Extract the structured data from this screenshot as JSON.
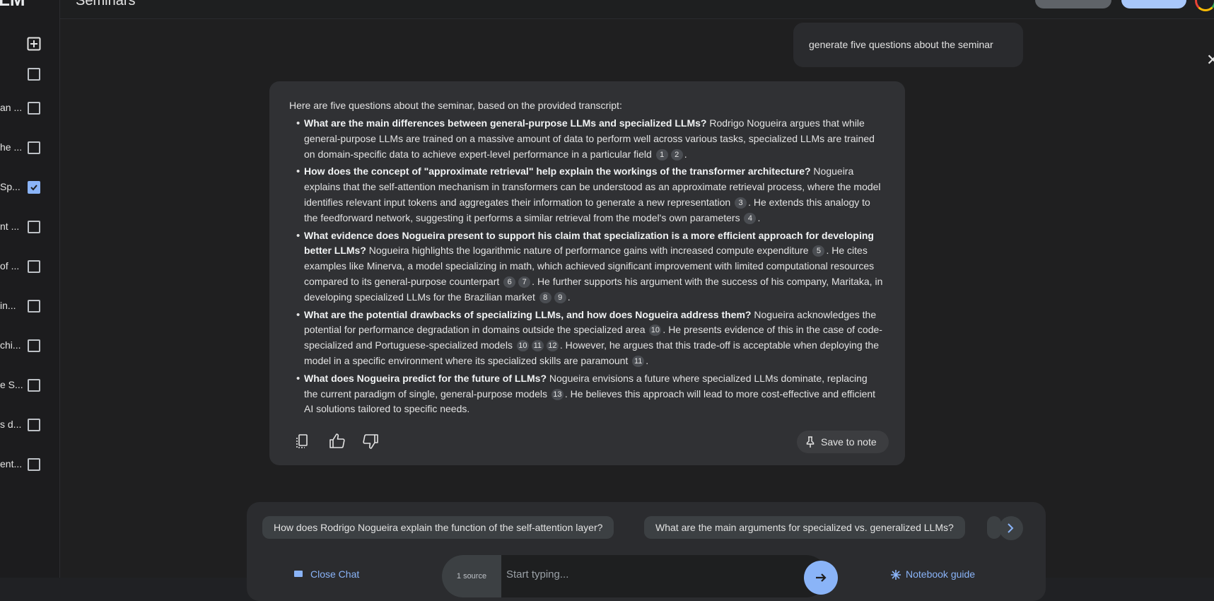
{
  "app": {
    "brand": "LM",
    "notebook_title": "Seminars"
  },
  "sidebar": {
    "sources": [
      {
        "label": "",
        "checked": false
      },
      {
        "label": "an ...",
        "checked": false
      },
      {
        "label": "he ...",
        "checked": false
      },
      {
        "label": "Sp...",
        "checked": true
      },
      {
        "label": "nt ...",
        "checked": false
      },
      {
        "label": "of ...",
        "checked": false
      },
      {
        "label": "in...",
        "checked": false
      },
      {
        "label": "chi...",
        "checked": false
      },
      {
        "label": "e S...",
        "checked": false
      },
      {
        "label": "s d...",
        "checked": false
      },
      {
        "label": "ent...",
        "checked": false
      }
    ]
  },
  "chat": {
    "user_message": "generate five questions about the seminar",
    "response": {
      "intro": "Here are five questions about the seminar, based on the provided transcript:",
      "items": [
        {
          "question": "What are the main differences between general-purpose LLMs and specialized LLMs?",
          "segments": [
            {
              "text": " Rodrigo Nogueira argues that while general-purpose LLMs are trained on a massive amount of data to perform well across various tasks, specialized LLMs are trained on domain-specific data to achieve expert-level performance in a particular field "
            },
            {
              "cite": "1"
            },
            {
              "cite": "2"
            },
            {
              "text": "."
            }
          ]
        },
        {
          "question": "How does the concept of \"approximate retrieval\" help explain the workings of the transformer architecture?",
          "segments": [
            {
              "text": " Nogueira explains that the self-attention mechanism in transformers can be understood as an approximate retrieval process, where the model identifies relevant input tokens and aggregates their information to generate a new representation "
            },
            {
              "cite": "3"
            },
            {
              "text": ". He extends this analogy to the feedforward network, suggesting it performs a similar retrieval from the model's own parameters "
            },
            {
              "cite": "4"
            },
            {
              "text": "."
            }
          ]
        },
        {
          "question": "What evidence does Nogueira present to support his claim that specialization is a more efficient approach for developing better LLMs?",
          "segments": [
            {
              "text": " Nogueira highlights the logarithmic nature of performance gains with increased compute expenditure "
            },
            {
              "cite": "5"
            },
            {
              "text": ". He cites examples like Minerva, a model specializing in math, which achieved significant improvement with limited computational resources compared to its general-purpose counterpart "
            },
            {
              "cite": "6"
            },
            {
              "cite": "7"
            },
            {
              "text": ". He further supports his argument with the success of his company, Maritaka, in developing specialized LLMs for the Brazilian market "
            },
            {
              "cite": "8"
            },
            {
              "cite": "9"
            },
            {
              "text": "."
            }
          ]
        },
        {
          "question": "What are the potential drawbacks of specializing LLMs, and how does Nogueira address them?",
          "segments": [
            {
              "text": " Nogueira acknowledges the potential for performance degradation in domains outside the specialized area "
            },
            {
              "cite": "10"
            },
            {
              "text": ". He presents evidence of this in the case of code-specialized and Portuguese-specialized models "
            },
            {
              "cite": "10"
            },
            {
              "cite": "11"
            },
            {
              "cite": "12"
            },
            {
              "text": ". However, he argues that this trade-off is acceptable when deploying the model in a specific environment where its specialized skills are paramount "
            },
            {
              "cite": "11"
            },
            {
              "text": "."
            }
          ]
        },
        {
          "question": "What does Nogueira predict for the future of LLMs?",
          "segments": [
            {
              "text": " Nogueira envisions a future where specialized LLMs dominate, replacing the current paradigm of single, general-purpose models "
            },
            {
              "cite": "13"
            },
            {
              "text": ". He believes this approach will lead to more cost-effective and efficient AI solutions tailored to specific needs."
            }
          ]
        }
      ],
      "save_label": "Save to note"
    }
  },
  "suggestions": [
    "How does Rodrigo Nogueira explain the function of the self-attention layer?",
    "What are the main arguments for specialized vs. generalized LLMs?"
  ],
  "bottom": {
    "close_chat": "Close Chat",
    "source_count": "1 source",
    "input_placeholder": "Start typing...",
    "notebook_guide": "Notebook guide"
  },
  "colors": {
    "accent": "#8ab4f8",
    "card": "#303134",
    "background": "#1f1f20"
  }
}
